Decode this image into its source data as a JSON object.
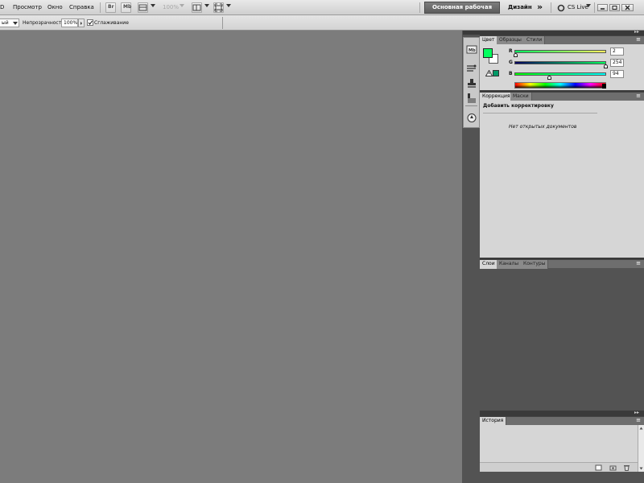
{
  "menu": {
    "cut_item": "D",
    "items": [
      "Просмотр",
      "Окно",
      "Справка"
    ]
  },
  "toolbar": {
    "zoom_value": "100%",
    "workspace_label": "Основная рабочая среда",
    "design_label": "Дизайн",
    "overflow_label": "»",
    "cslive_label": "CS Live"
  },
  "options": {
    "cut_select_value": "ый",
    "opacity_label": "Непрозрачность:",
    "opacity_value": "100%",
    "smoothing_label": "Сглаживание",
    "smoothing_checked": true
  },
  "color_panel": {
    "tabs": [
      "Цвет",
      "Образцы",
      "Стили"
    ],
    "channels": [
      {
        "label": "R",
        "value": "2"
      },
      {
        "label": "G",
        "value": "254"
      },
      {
        "label": "B",
        "value": "94"
      }
    ],
    "foreground": "#02FE5E",
    "background": "#FFFFFF",
    "web_safe_swatch": "#009966"
  },
  "adjust_panel": {
    "tabs": [
      "Коррекция",
      "Маски"
    ],
    "heading": "Добавить корректировку",
    "empty_message": "Нет открытых документов"
  },
  "layers_panel": {
    "tabs": [
      "Слои",
      "Каналы",
      "Контуры"
    ]
  },
  "history_panel": {
    "tabs": [
      "История"
    ]
  },
  "colors": {
    "canvas": "#7C7C7C",
    "chrome": "#535353",
    "panel": "#D6D6D6"
  }
}
